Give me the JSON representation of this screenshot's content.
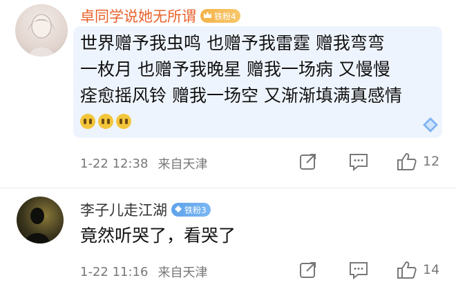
{
  "comments": [
    {
      "username": "卓同学说她无所谓",
      "badge": "铁粉4",
      "body_lines": [
        "世界赠予我虫鸣 也赠予我雷霆 赠我弯弯",
        "一枚月 也赠予我晚星 赠我一场病 又慢慢",
        "痊愈摇风铃 赠我一场空 又渐渐填满真感情"
      ],
      "emojis": [
        "crying-face",
        "crying-face",
        "crying-face"
      ],
      "time": "1-22 12:38",
      "location": "来自天津",
      "likes": "12",
      "username_color": "#e8622c"
    },
    {
      "username": "李子儿走江湖",
      "badge": "铁粉3",
      "body_lines": [
        "竟然听哭了，看哭了"
      ],
      "time": "1-22 11:16",
      "location": "来自天津",
      "likes": "14",
      "username_color": "#333333"
    }
  ],
  "icons": {
    "share": "share-icon",
    "comment": "comment-icon",
    "like": "thumbs-up-icon",
    "badge": "diamond-icon"
  }
}
